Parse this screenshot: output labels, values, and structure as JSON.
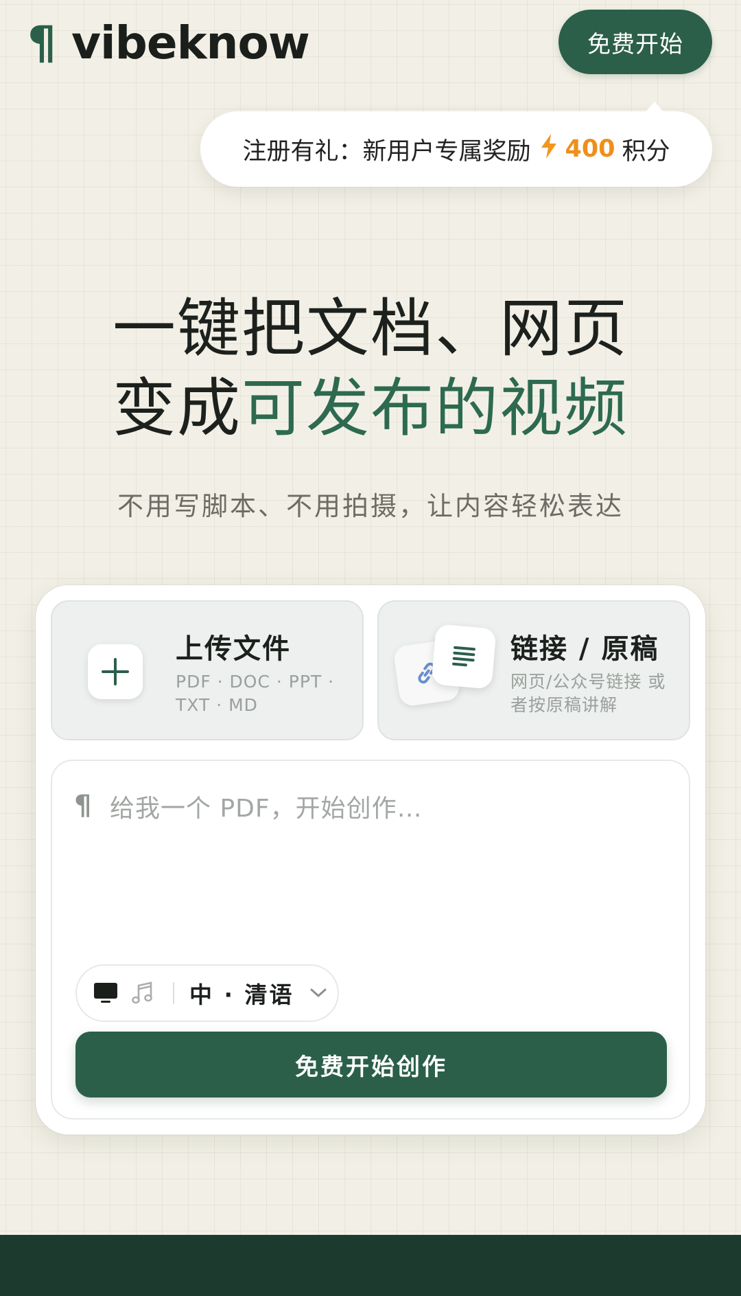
{
  "header": {
    "logo_mark": "¶",
    "logo_text": "vibeknow",
    "cta_label": "免费开始"
  },
  "promo": {
    "text": "注册有礼：新用户专属奖励",
    "bolt_icon": "lightning-icon",
    "points_value": "400",
    "points_unit": "积分"
  },
  "hero": {
    "line1": "一键把文档、网页",
    "line2_prefix": "变成",
    "line2_accent": "可发布的视频",
    "subtitle": "不用写脚本、不用拍摄，让内容轻松表达"
  },
  "upload_tile": {
    "icon": "plus-icon",
    "title": "上传文件",
    "formats": "PDF · DOC · PPT · TXT · MD"
  },
  "link_tile": {
    "icon": "link-document-icon",
    "title": "链接 / 原稿",
    "desc": "网页/公众号链接 或者按原稿讲解"
  },
  "composer": {
    "pilcrow": "¶",
    "placeholder": "给我一个 PDF，开始创作…",
    "mode_icons": [
      "monitor-icon",
      "music-note-icon"
    ],
    "language": "中 · 清语",
    "submit_label": "免费开始创作"
  },
  "colors": {
    "brand_green": "#2b5f4a",
    "accent_orange": "#ee8f1b",
    "background": "#f2f0e6",
    "footer": "#1d3a2e"
  }
}
